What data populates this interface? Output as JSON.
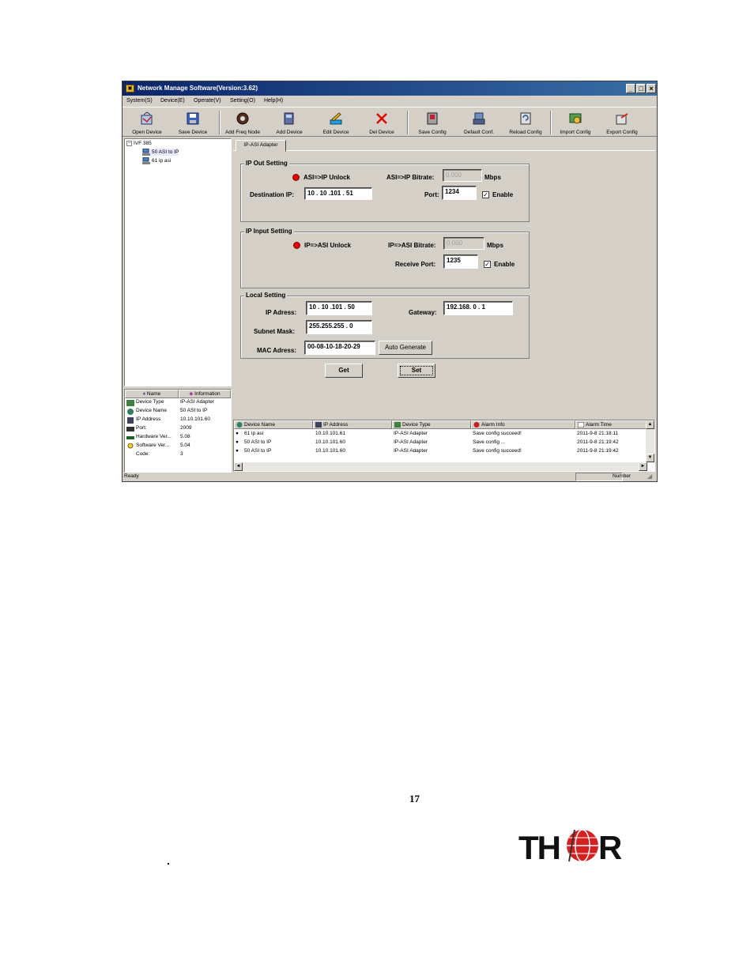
{
  "window": {
    "title": "Network Manage Software(Version:3.62)",
    "controls": {
      "minimize": "_",
      "maximize": "□",
      "close": "×"
    }
  },
  "menu": [
    "System(S)",
    "Device(E)",
    "Operate(V)",
    "Setting(O)",
    "Help(H)"
  ],
  "toolbar": [
    {
      "label": "Open Device",
      "icon": "open-device-icon"
    },
    {
      "label": "Save Device",
      "icon": "save-device-icon"
    },
    {
      "label": "Add Freq Node",
      "icon": "add-freq-node-icon"
    },
    {
      "label": "Add Device",
      "icon": "add-device-icon"
    },
    {
      "label": "Edit Device",
      "icon": "edit-device-icon"
    },
    {
      "label": "Del Device",
      "icon": "delete-device-icon"
    },
    {
      "label": "Save Config",
      "icon": "save-config-icon"
    },
    {
      "label": "Default Conf.",
      "icon": "default-config-icon"
    },
    {
      "label": "Reload Config",
      "icon": "reload-config-icon"
    },
    {
      "label": "Import Config",
      "icon": "import-config-icon"
    },
    {
      "label": "Export Config",
      "icon": "export-config-icon"
    }
  ],
  "tree": {
    "expander": "−",
    "root": "IVF 385",
    "children": [
      "50 ASI to IP",
      "61 ip asi"
    ]
  },
  "info": {
    "headers": {
      "name": "Name",
      "information": "Information"
    },
    "rows": [
      {
        "name": "Device Type",
        "value": "IP-ASI Adapter"
      },
      {
        "name": "Device Name",
        "value": "50 ASI to IP"
      },
      {
        "name": "IP Address",
        "value": "10.10.101.60"
      },
      {
        "name": "Port:",
        "value": "2009"
      },
      {
        "name": "Hardware Ver...",
        "value": "5.08"
      },
      {
        "name": "Software Ver...",
        "value": "5.04"
      },
      {
        "name": "Code:",
        "value": "3"
      }
    ]
  },
  "tab": "IP-ASI Adapter",
  "ip_out": {
    "title": "IP Out Setting",
    "status": "ASI=>IP Unlock",
    "bitrate_label": "ASI=>IP Bitrate:",
    "bitrate_value": "0.000",
    "unit": "Mbps",
    "dest_label": "Destination IP:",
    "dest_value": "10 . 10 .101 . 51",
    "port_label": "Port:",
    "port_value": "1234",
    "enable_label": "Enable",
    "check_mark": "✓"
  },
  "ip_in": {
    "title": "IP Input Setting",
    "status": "IP=>ASI Unlock",
    "bitrate_label": "IP=>ASI Bitrate:",
    "bitrate_value": "0.000",
    "unit": "Mbps",
    "port_label": "Receive Port:",
    "port_value": "1235",
    "enable_label": "Enable",
    "check_mark": "✓"
  },
  "local": {
    "title": "Local Setting",
    "ip_label": "IP Adress:",
    "ip_value": "10 . 10 .101 . 50",
    "gateway_label": "Gateway:",
    "gateway_value": "192.168.  0  .  1",
    "mask_label": "Subnet Mask:",
    "mask_value": "255.255.255 .  0",
    "mac_label": "MAC Adress:",
    "mac_value": "00-08-10-18-20-29",
    "auto_button": "Auto Generate"
  },
  "buttons": {
    "get": "Get",
    "set": "Set"
  },
  "alarm": {
    "headers": [
      "Device Name",
      "IP Address",
      "Device Type",
      "Alarm Info",
      "Alarm Time"
    ],
    "rows": [
      [
        "61 ip asi",
        "10.10.101.61",
        "IP-ASI Adapter",
        "Save config succeed!",
        "2011-9-8 21:18:11"
      ],
      [
        "50 ASI to IP",
        "10.10.101.60",
        "IP-ASI Adapter",
        "Save config ...",
        "2011-9-8 21:19:42"
      ],
      [
        "50 ASI to IP",
        "10.10.101.60",
        "IP-ASI Adapter",
        "Save config succeed!",
        "2011-9-8 21:19:42"
      ]
    ],
    "scroll": {
      "up": "▲",
      "down": "▼",
      "left": "◄",
      "right": "►"
    }
  },
  "status": {
    "left": "Ready",
    "right": "Number"
  },
  "page": {
    "number": "17",
    "dot": "."
  },
  "logo": {
    "text": "THOR"
  },
  "colors": {
    "title_bar": "#0a246a",
    "led_red": "#e00000",
    "window_bg": "#d4d0c8"
  }
}
